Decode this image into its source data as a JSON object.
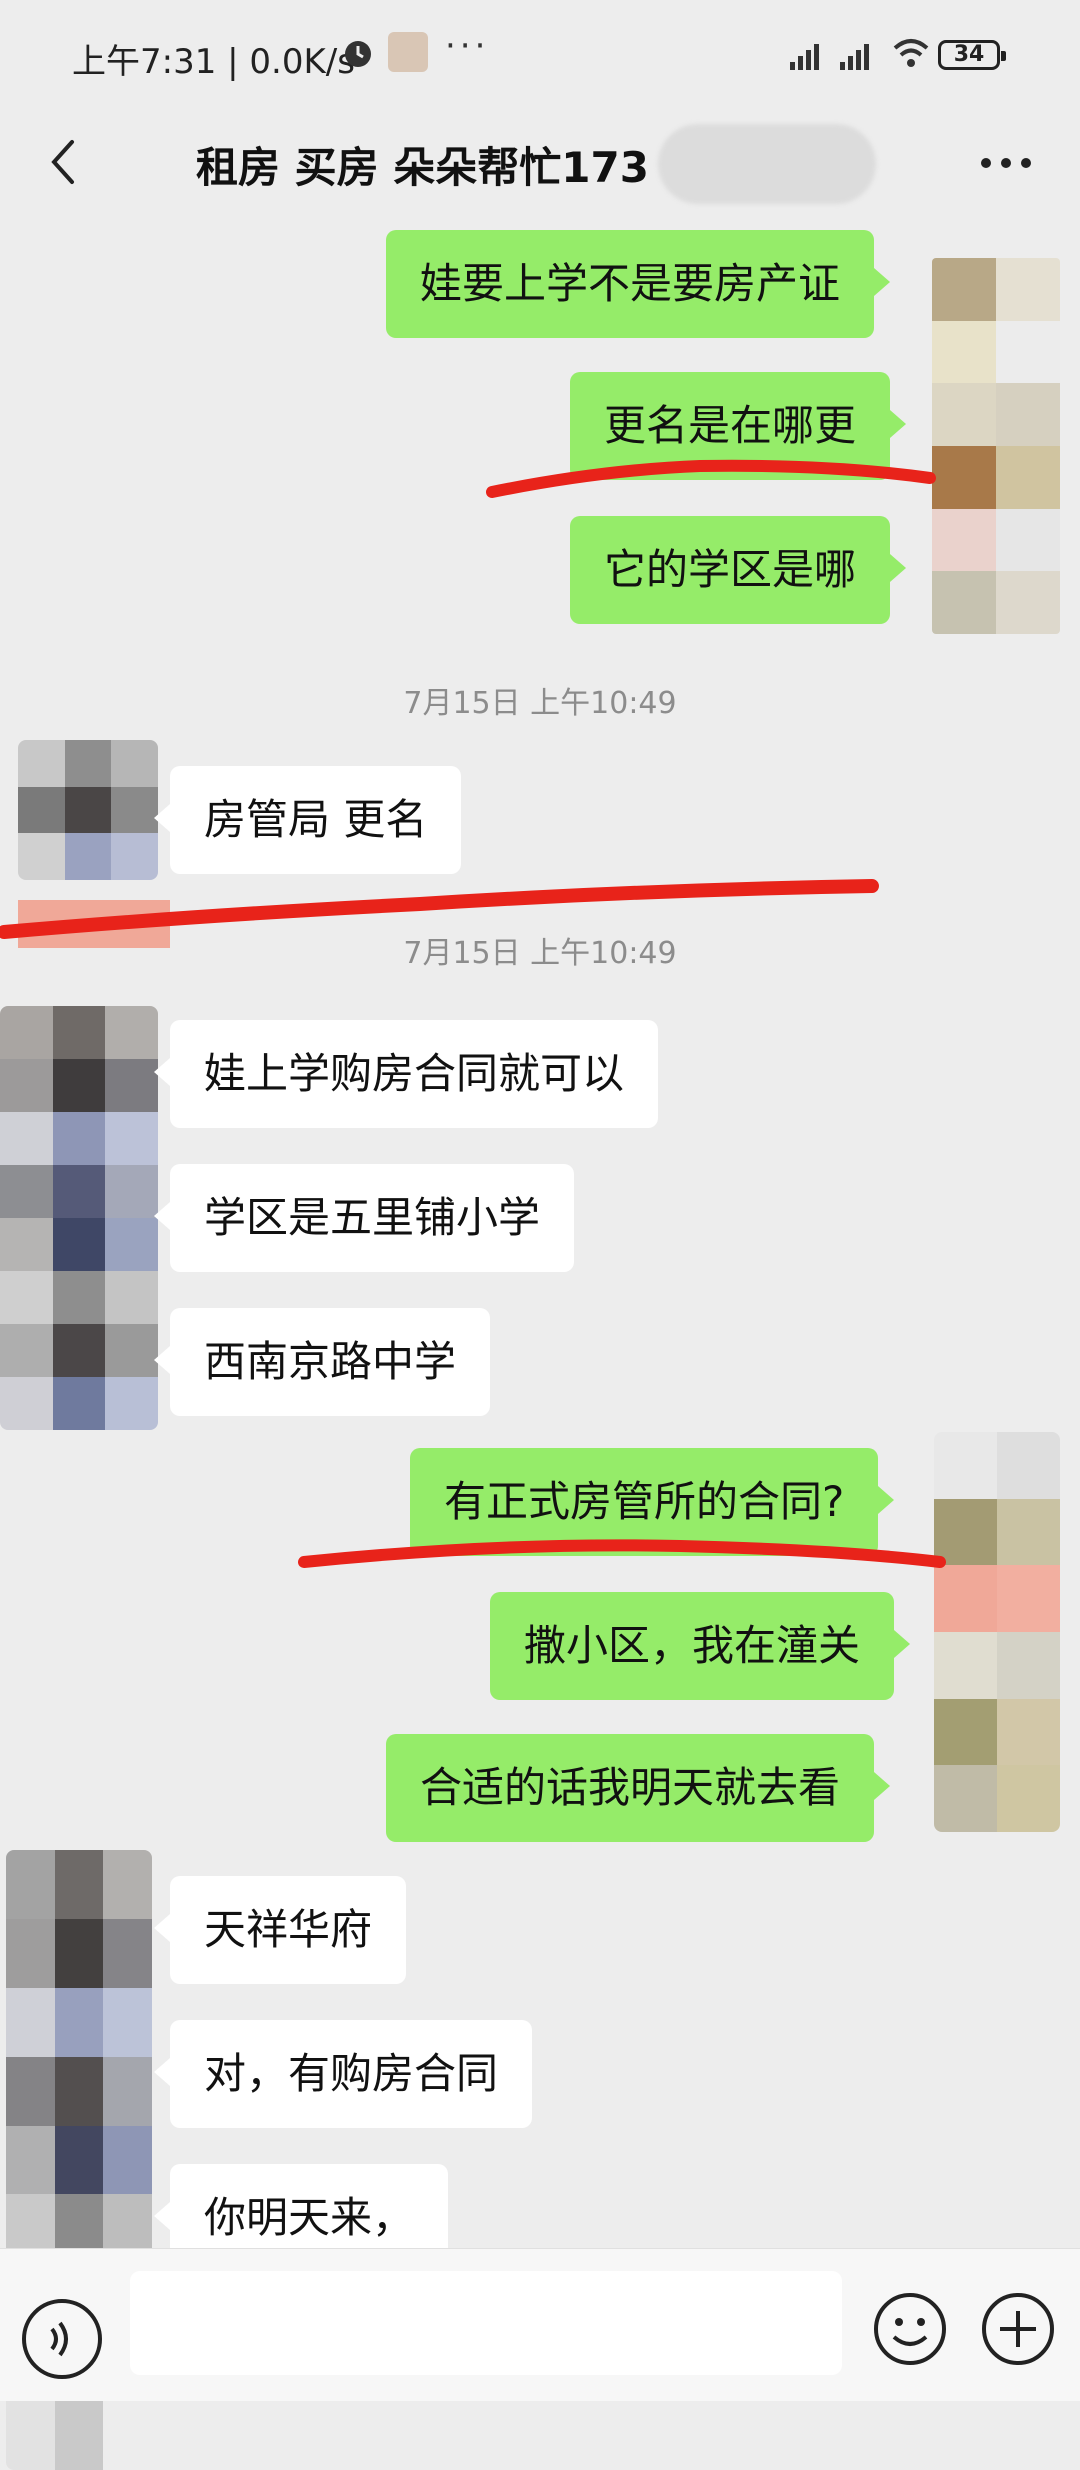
{
  "status_bar": {
    "time_speed": "上午7:31 | 0.0K/s",
    "more_dots": "···",
    "battery": "34"
  },
  "header": {
    "title": "租房 买房 朵朵帮忙173"
  },
  "timestamps": [
    "7月15日 上午10:49",
    "7月15日 上午10:49"
  ],
  "messages": [
    {
      "dir": "out",
      "text": "娃要上学不是要房产证"
    },
    {
      "dir": "out",
      "text": "更名是在哪更"
    },
    {
      "dir": "out",
      "text": "它的学区是哪"
    },
    {
      "dir": "in",
      "text": "房管局 更名"
    },
    {
      "dir": "in",
      "text": "娃上学购房合同就可以"
    },
    {
      "dir": "in",
      "text": "学区是五里铺小学"
    },
    {
      "dir": "in",
      "text": "西南京路中学"
    },
    {
      "dir": "out",
      "text": "有正式房管所的合同?"
    },
    {
      "dir": "out",
      "text": "撒小区，我在潼关"
    },
    {
      "dir": "out",
      "text": "合适的话我明天就去看"
    },
    {
      "dir": "in",
      "text": "天祥华府"
    },
    {
      "dir": "in",
      "text": "对，有购房合同"
    },
    {
      "dir": "in",
      "text": "你明天来，"
    }
  ],
  "colors": {
    "out_bubble": "#95EC69",
    "in_bubble": "#FFFFFF",
    "background": "#EDEDED",
    "annotation": "#E8231A"
  },
  "icons": {
    "back": "back-chevron-icon",
    "more": "more-dots-icon",
    "voice": "voice-icon",
    "emoji": "emoji-icon",
    "plus": "plus-icon"
  }
}
